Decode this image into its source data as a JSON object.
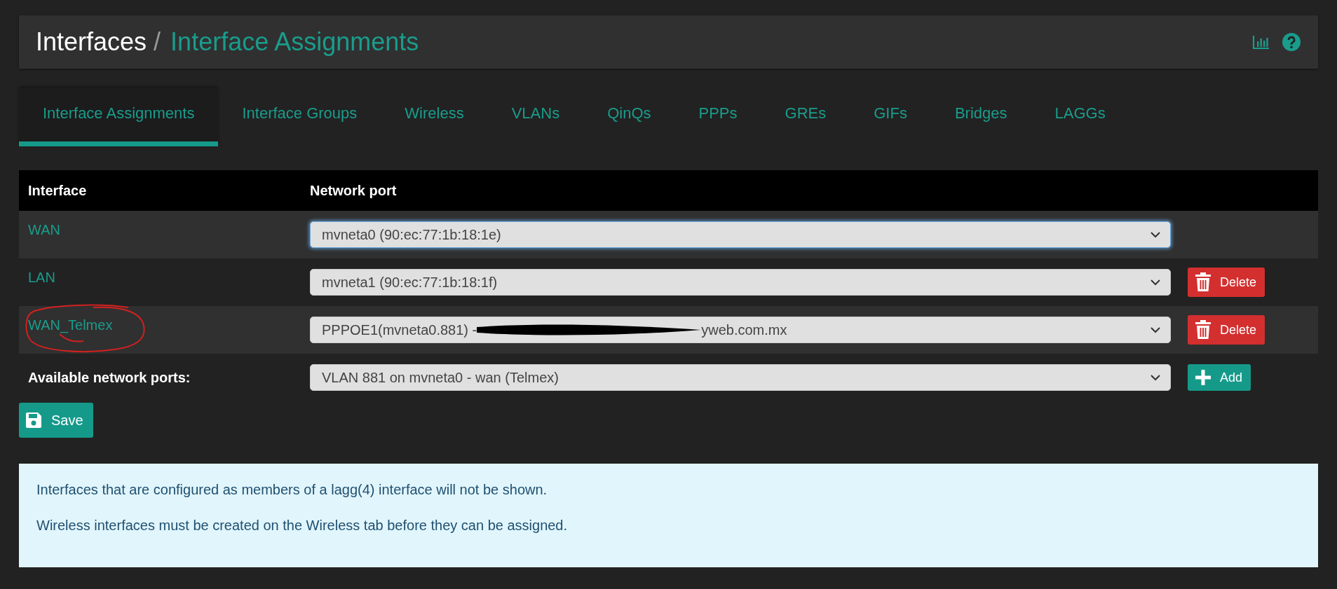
{
  "breadcrumb": {
    "section": "Interfaces",
    "separator": "/",
    "page": "Interface Assignments"
  },
  "tabs": [
    {
      "label": "Interface Assignments",
      "selected": true
    },
    {
      "label": "Interface Groups",
      "selected": false
    },
    {
      "label": "Wireless",
      "selected": false
    },
    {
      "label": "VLANs",
      "selected": false
    },
    {
      "label": "QinQs",
      "selected": false
    },
    {
      "label": "PPPs",
      "selected": false
    },
    {
      "label": "GREs",
      "selected": false
    },
    {
      "label": "GIFs",
      "selected": false
    },
    {
      "label": "Bridges",
      "selected": false
    },
    {
      "label": "LAGGs",
      "selected": false
    }
  ],
  "table": {
    "columns": [
      "Interface",
      "Network port"
    ],
    "rows": [
      {
        "interface": "WAN",
        "port": "mvneta0 (90:ec:77:1b:18:1e)",
        "focused": true,
        "deletable": false,
        "circled": false
      },
      {
        "interface": "LAN",
        "port": "mvneta1 (90:ec:77:1b:18:1f)",
        "focused": false,
        "deletable": true,
        "delete_label": "Delete",
        "circled": false
      },
      {
        "interface": "WAN_Telmex",
        "port": "PPPOE1(mvneta0.881) - ",
        "port_end": "yweb.com.mx",
        "redacted": true,
        "focused": false,
        "deletable": true,
        "delete_label": "Delete",
        "circled": true
      }
    ],
    "available": {
      "label": "Available network ports:",
      "port": "VLAN 881 on mvneta0 - wan (Telmex)",
      "add_label": "Add"
    }
  },
  "save_label": "Save",
  "info": [
    "Interfaces that are configured as members of a lagg(4) interface will not be shown.",
    "Wireless interfaces must be created on the Wireless tab before they can be assigned."
  ]
}
